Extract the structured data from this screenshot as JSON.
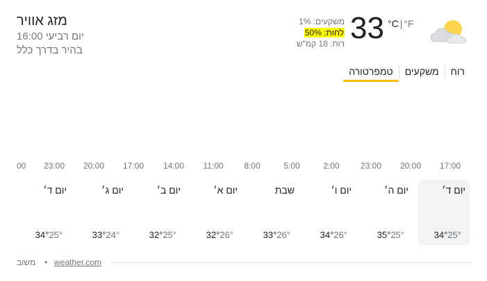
{
  "location": {
    "title": "מזג אוויר",
    "time": "יום רביעי 16:00",
    "condition": "בהיר בדרך כלל"
  },
  "current": {
    "icon": "partly-cloudy-icon",
    "temp": "33",
    "unit_c": "°C",
    "unit_sep": "|",
    "unit_f": "°F",
    "precip": "משקעים: 1%",
    "humidity": "לחות: 50%",
    "wind": "רוח: 18 קמ\"ש"
  },
  "tabs": [
    {
      "label": "טמפרטורה",
      "active": true
    },
    {
      "label": "משקעים",
      "active": false
    },
    {
      "label": "רוח",
      "active": false
    }
  ],
  "hours": [
    "17:00",
    "20:00",
    "23:00",
    "2:00",
    "5:00",
    "8:00",
    "11:00",
    "14:00",
    "17:00",
    "20:00",
    "23:00",
    "00"
  ],
  "days": [
    {
      "name": "יום ד׳",
      "high": "34°",
      "low": "25°",
      "selected": true
    },
    {
      "name": "יום ה׳",
      "high": "35°",
      "low": "25°"
    },
    {
      "name": "יום ו׳",
      "high": "34°",
      "low": "26°"
    },
    {
      "name": "שבת",
      "high": "33°",
      "low": "26°"
    },
    {
      "name": "יום א׳",
      "high": "32°",
      "low": "26°"
    },
    {
      "name": "יום ב׳",
      "high": "32°",
      "low": "25°"
    },
    {
      "name": "יום ג׳",
      "high": "33°",
      "low": "24°"
    },
    {
      "name": "יום ד׳",
      "high": "34°",
      "low": "25°"
    }
  ],
  "footer": {
    "source_label": "משוב",
    "dot": "•",
    "source_link": "weather.com"
  },
  "colors": {
    "accent": "#fbbc04",
    "highlight": "#ffff00",
    "selected_bg": "#f1f3f4"
  }
}
